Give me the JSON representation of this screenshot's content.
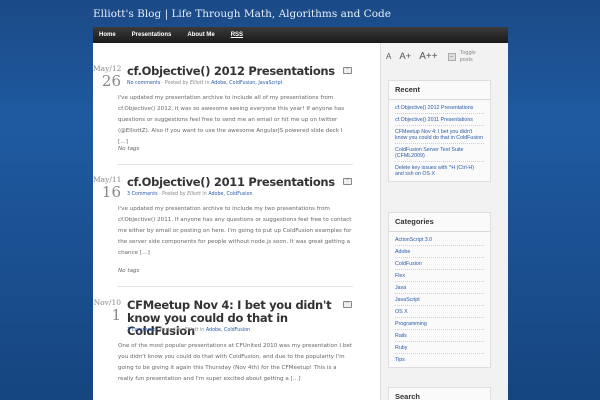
{
  "site": {
    "title": "Elliott's Blog | Life Through Math, Algorithms and Code"
  },
  "nav": {
    "items": [
      "Home",
      "Presentations",
      "About Me",
      "RSS"
    ]
  },
  "font_tools": {
    "small": "A",
    "medium": "A+",
    "large": "A++",
    "toggle": "Toggle posts"
  },
  "posts": [
    {
      "month": "May/12",
      "day": "26",
      "title": "cf.Objective() 2012 Presentations",
      "comments": "No comments",
      "posted_by": "· Posted by",
      "author": "Elliott",
      "in": "in",
      "categories": "Adobe, ColdFusion, JavaScript",
      "excerpt": "I've updated my presentation archive to include all of my presentations from cf.Objective() 2012, it was so awesome seeing everyone this year! If anyone has questions or suggestions feel free to send me an email or hit me up on twitter (@ElliottZ). Also if you want to use the awesome AngularJS powered slide deck I […]",
      "tags": "No tags"
    },
    {
      "month": "May/11",
      "day": "16",
      "title": "cf.Objective() 2011 Presentations",
      "comments": "3 Comments",
      "posted_by": "· Posted by",
      "author": "Elliott",
      "in": "in",
      "categories": "Adobe, ColdFusion",
      "excerpt": "I've updated my presentation archive to include my two presentations from cf.Objective() 2011. If anyone has any questions or suggestions feel free to contact me either by email or posting on here. I'm going to put up ColdFusion examples for the server side components for people without node.js soon. It was great getting a chance […]",
      "tags": "No tags"
    },
    {
      "month": "Nov/10",
      "day": "1",
      "title": "CFMeetup Nov 4: I bet you didn't know you could do that in ColdFusion",
      "comments": "1 Comment",
      "posted_by": "· Posted by",
      "author": "Elliott",
      "in": "in",
      "categories": "Adobe, ColdFusion",
      "excerpt": "One of the most popular presentations at CFUnited 2010 was my presentation I bet you didn't know you could do that with ColdFusion, and due to the popularity I'm going to be giving it again this Thursday (Nov 4th) for the CFMeetup! This is a really fun presentation and I'm super excited about getting a […]",
      "tags": ""
    }
  ],
  "sidebar": {
    "recent": {
      "title": "Recent",
      "items": [
        "cf.Objective() 2012 Presentations",
        "cf.Objective() 2011 Presentations",
        "CFMeetup Nov 4: I bet you didn't know you could do that in ColdFusion",
        "ColdFusion Server Test Suite (CFML2009)",
        "Delete key issues with ^H (Ctrl-H) and ssh on OS X"
      ]
    },
    "categories": {
      "title": "Categories",
      "items": [
        "ActionScript 3.0",
        "Adobe",
        "ColdFusion",
        "Flex",
        "Java",
        "JavaScript",
        "OS X",
        "Programming",
        "Rails",
        "Ruby",
        "Tips"
      ]
    },
    "search": {
      "title": "Search"
    }
  }
}
